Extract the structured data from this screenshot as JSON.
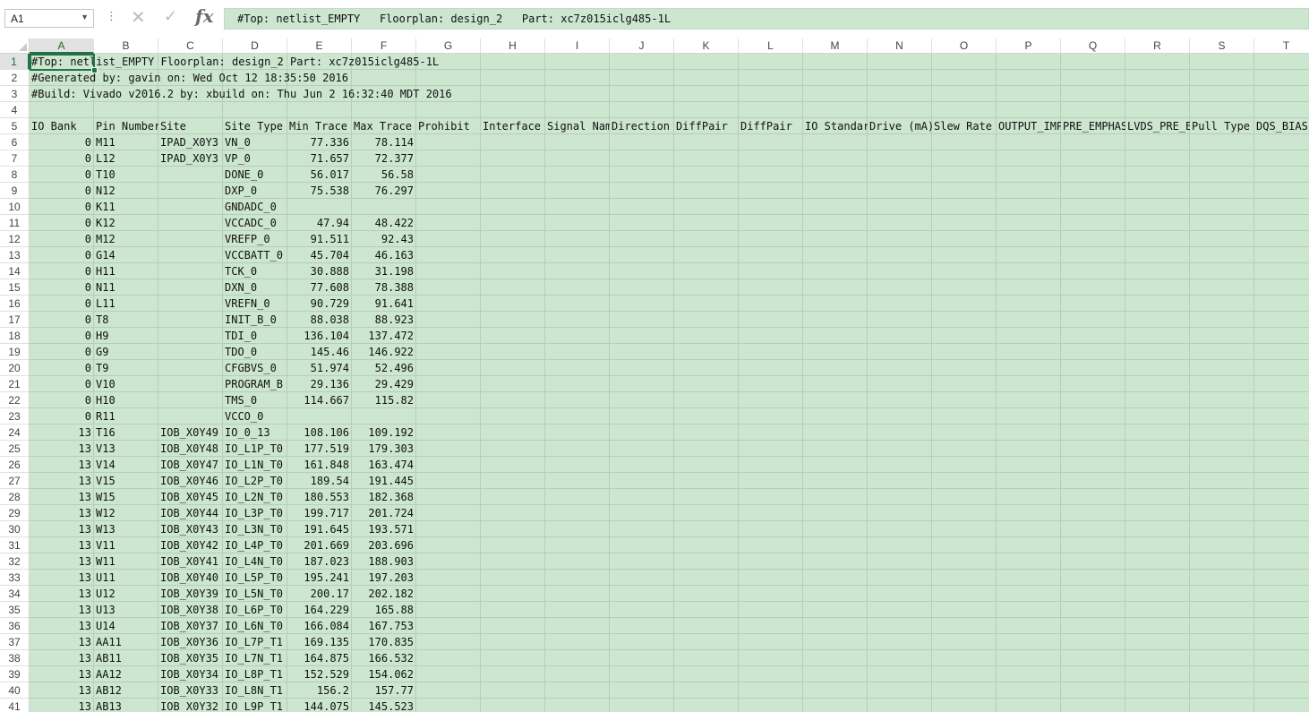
{
  "formula_bar": {
    "name_box": "A1",
    "cancel_glyph": "✕",
    "enter_glyph": "✓",
    "fx_glyph": "fx",
    "formula": "#Top: netlist_EMPTY   Floorplan: design_2   Part: xc7z015iclg485-1L"
  },
  "grid": {
    "selected_cell": "A1",
    "columns": [
      "A",
      "B",
      "C",
      "D",
      "E",
      "F",
      "G",
      "H",
      "I",
      "J",
      "K",
      "L",
      "M",
      "N",
      "O",
      "P",
      "Q",
      "R",
      "S",
      "T"
    ],
    "row_numbers": [
      "1",
      "2",
      "3",
      "4",
      "5",
      "6",
      "7",
      "8",
      "9",
      "10",
      "11",
      "12",
      "13",
      "14",
      "15",
      "16",
      "17",
      "18",
      "19",
      "20",
      "21",
      "22",
      "23",
      "24",
      "25",
      "26",
      "27",
      "28",
      "29",
      "30",
      "31",
      "32",
      "33",
      "34",
      "35",
      "36",
      "37",
      "38",
      "39",
      "40",
      "41"
    ],
    "fill_color": "#cde6cf",
    "selection_color": "#217346",
    "header_rows": [
      "#Top: netlist_EMPTY   Floorplan: design_2   Part: xc7z015iclg485-1L",
      "#Generated by: gavin   on: Wed Oct 12 18:35:50 2016",
      "#Build: Vivado v2016.2   by: xbuild   on: Thu Jun  2 16:32:40 MDT 2016",
      ""
    ],
    "column_headers": [
      "IO Bank",
      "Pin Number",
      "Site",
      "Site Type",
      "Min Trace",
      "Max Trace",
      "Prohibit",
      "Interface",
      "Signal Name",
      "Direction",
      "DiffPair",
      "DiffPair",
      "IO Standard",
      "Drive (mA)",
      "Slew Rate",
      "OUTPUT_IMPEDANCE",
      "PRE_EMPHASIS",
      "LVDS_PRE_EMPHASIS",
      "Pull Type",
      "DQS_BIAS"
    ],
    "data_rows": [
      [
        "0",
        "M11",
        "IPAD_X0Y3",
        "VN_0",
        "77.336",
        "78.114"
      ],
      [
        "0",
        "L12",
        "IPAD_X0Y3",
        "VP_0",
        "71.657",
        "72.377"
      ],
      [
        "0",
        "T10",
        "",
        "DONE_0",
        "56.017",
        "56.58"
      ],
      [
        "0",
        "N12",
        "",
        "DXP_0",
        "75.538",
        "76.297"
      ],
      [
        "0",
        "K11",
        "",
        "GNDADC_0",
        "",
        ""
      ],
      [
        "0",
        "K12",
        "",
        "VCCADC_0",
        "47.94",
        "48.422"
      ],
      [
        "0",
        "M12",
        "",
        "VREFP_0",
        "91.511",
        "92.43"
      ],
      [
        "0",
        "G14",
        "",
        "VCCBATT_0",
        "45.704",
        "46.163"
      ],
      [
        "0",
        "H11",
        "",
        "TCK_0",
        "30.888",
        "31.198"
      ],
      [
        "0",
        "N11",
        "",
        "DXN_0",
        "77.608",
        "78.388"
      ],
      [
        "0",
        "L11",
        "",
        "VREFN_0",
        "90.729",
        "91.641"
      ],
      [
        "0",
        "T8",
        "",
        "INIT_B_0",
        "88.038",
        "88.923"
      ],
      [
        "0",
        "H9",
        "",
        "TDI_0",
        "136.104",
        "137.472"
      ],
      [
        "0",
        "G9",
        "",
        "TDO_0",
        "145.46",
        "146.922"
      ],
      [
        "0",
        "T9",
        "",
        "CFGBVS_0",
        "51.974",
        "52.496"
      ],
      [
        "0",
        "V10",
        "",
        "PROGRAM_B",
        "29.136",
        "29.429"
      ],
      [
        "0",
        "H10",
        "",
        "TMS_0",
        "114.667",
        "115.82"
      ],
      [
        "0",
        "R11",
        "",
        "VCCO_0",
        "",
        ""
      ],
      [
        "13",
        "T16",
        "IOB_X0Y49",
        "IO_0_13",
        "108.106",
        "109.192"
      ],
      [
        "13",
        "V13",
        "IOB_X0Y48",
        "IO_L1P_T0",
        "177.519",
        "179.303"
      ],
      [
        "13",
        "V14",
        "IOB_X0Y47",
        "IO_L1N_T0",
        "161.848",
        "163.474"
      ],
      [
        "13",
        "V15",
        "IOB_X0Y46",
        "IO_L2P_T0",
        "189.54",
        "191.445"
      ],
      [
        "13",
        "W15",
        "IOB_X0Y45",
        "IO_L2N_T0",
        "180.553",
        "182.368"
      ],
      [
        "13",
        "W12",
        "IOB_X0Y44",
        "IO_L3P_T0",
        "199.717",
        "201.724"
      ],
      [
        "13",
        "W13",
        "IOB_X0Y43",
        "IO_L3N_T0",
        "191.645",
        "193.571"
      ],
      [
        "13",
        "V11",
        "IOB_X0Y42",
        "IO_L4P_T0",
        "201.669",
        "203.696"
      ],
      [
        "13",
        "W11",
        "IOB_X0Y41",
        "IO_L4N_T0",
        "187.023",
        "188.903"
      ],
      [
        "13",
        "U11",
        "IOB_X0Y40",
        "IO_L5P_T0",
        "195.241",
        "197.203"
      ],
      [
        "13",
        "U12",
        "IOB_X0Y39",
        "IO_L5N_T0",
        "200.17",
        "202.182"
      ],
      [
        "13",
        "U13",
        "IOB_X0Y38",
        "IO_L6P_T0",
        "164.229",
        "165.88"
      ],
      [
        "13",
        "U14",
        "IOB_X0Y37",
        "IO_L6N_T0",
        "166.084",
        "167.753"
      ],
      [
        "13",
        "AA11",
        "IOB_X0Y36",
        "IO_L7P_T1",
        "169.135",
        "170.835"
      ],
      [
        "13",
        "AB11",
        "IOB_X0Y35",
        "IO_L7N_T1",
        "164.875",
        "166.532"
      ],
      [
        "13",
        "AA12",
        "IOB_X0Y34",
        "IO_L8P_T1",
        "152.529",
        "154.062"
      ],
      [
        "13",
        "AB12",
        "IOB_X0Y33",
        "IO_L8N_T1",
        "156.2",
        "157.77"
      ],
      [
        "13",
        "AB13",
        "IOB_X0Y32",
        "IO_L9P_T1",
        "144.075",
        "145.523"
      ]
    ]
  }
}
